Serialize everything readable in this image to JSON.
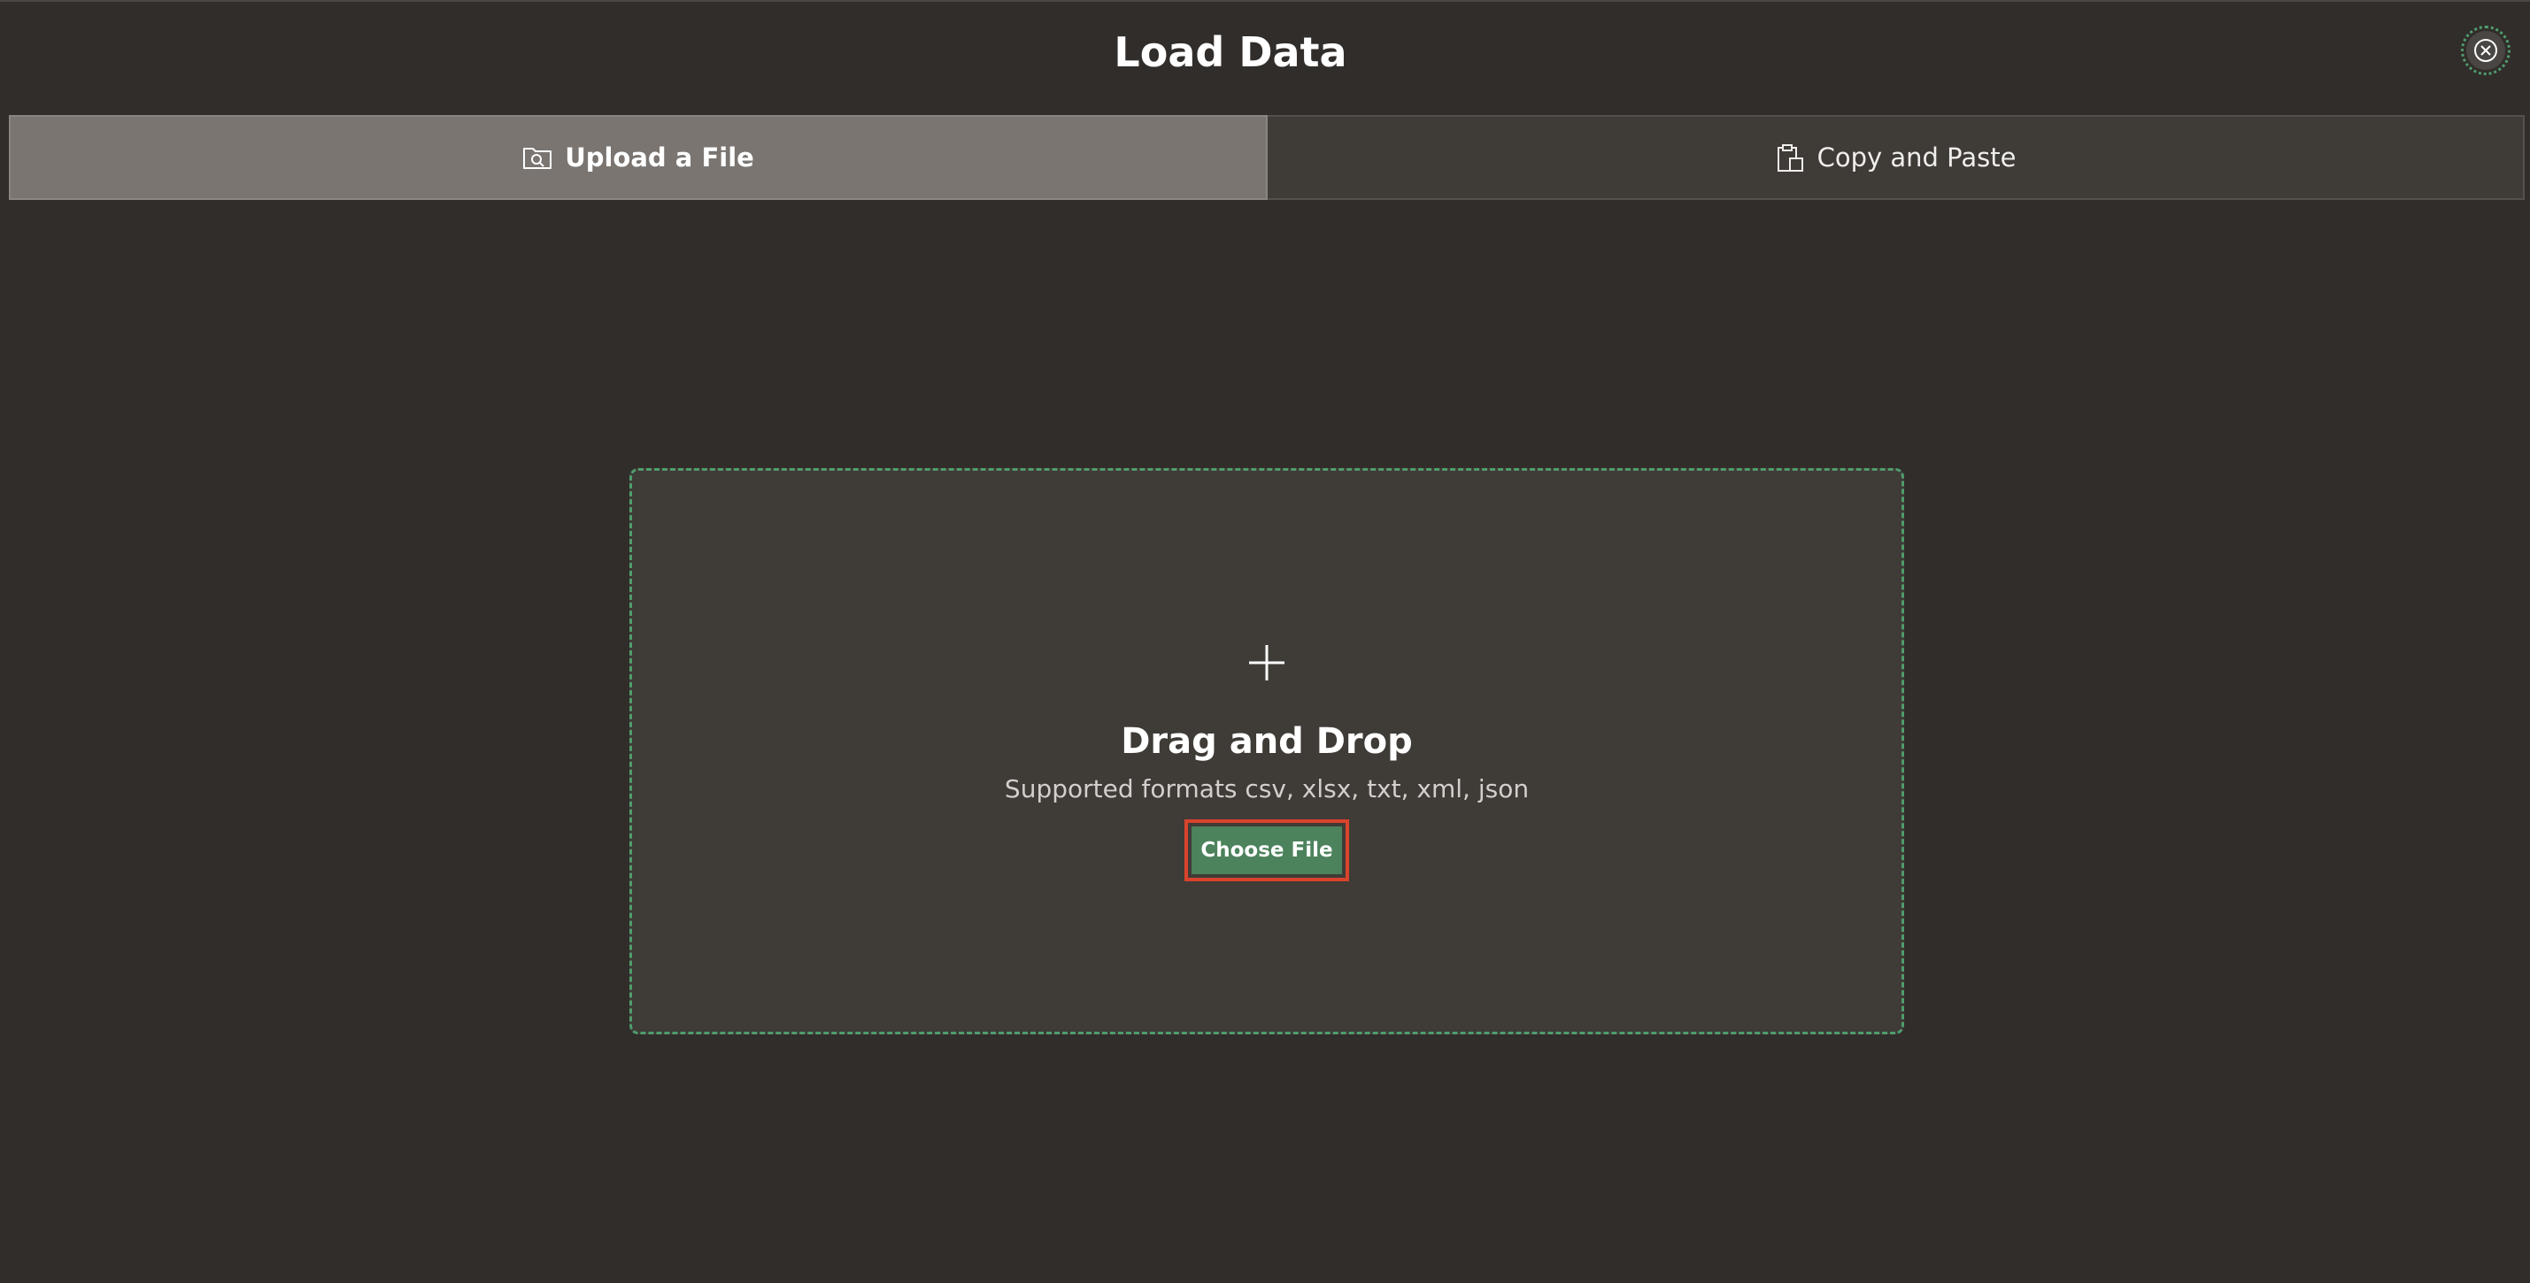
{
  "dialog": {
    "title": "Load Data",
    "close_icon": "close-icon"
  },
  "tabs": [
    {
      "label": "Upload a File",
      "icon": "folder-search-icon",
      "selected": true
    },
    {
      "label": "Copy and Paste",
      "icon": "clipboard-icon",
      "selected": false
    }
  ],
  "dropzone": {
    "icon": "plus-icon",
    "title": "Drag and Drop",
    "subtitle": "Supported formats csv, xlsx, txt, xml, json",
    "button_label": "Choose File"
  },
  "colors": {
    "background": "#312d2a",
    "selected_tab": "#7a7571",
    "unselected_tab": "#3f3b37",
    "dropzone_border": "#4f9d6e",
    "button": "#4c825c",
    "highlight": "#d9432c"
  }
}
